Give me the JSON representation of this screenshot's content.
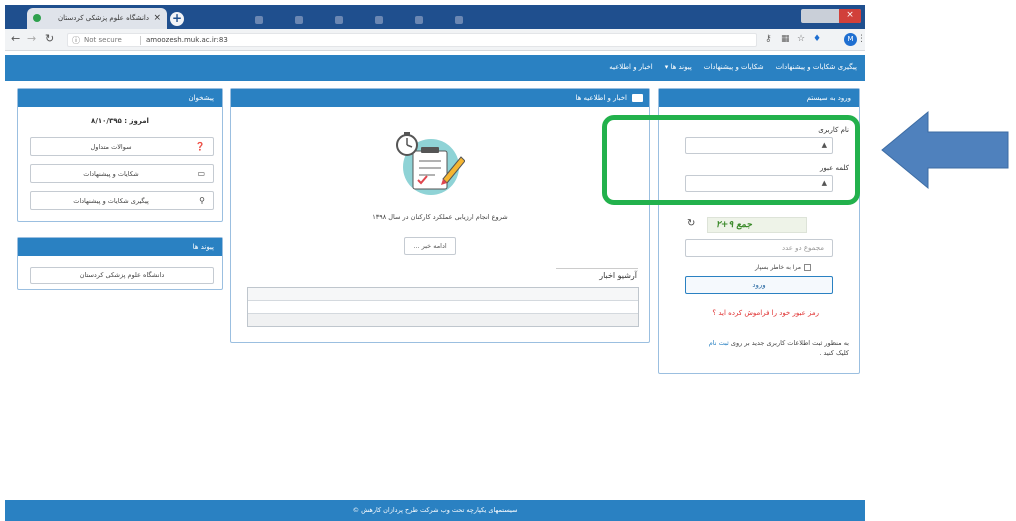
{
  "browser": {
    "tab_title": "دانشگاه علوم پزشکی کردستان",
    "tab_close": "×",
    "new_tab": "+",
    "security_icon": "info-circle-icon",
    "security_label": "Not secure",
    "url": "amoozesh.muk.ac.ir:83",
    "window_close": "×"
  },
  "nav": {
    "items": [
      "اخبار و اطلاعیه",
      "پیوند ها ▾",
      "شکایات و پیشنهادات",
      "پیگیری شکایات و پیشنهادات"
    ]
  },
  "login": {
    "header": "ورود به سیستم",
    "username_label": "نام کاربری",
    "password_label": "کلمه عبور",
    "captcha_text": "جمع ۹+۲",
    "sum_placeholder": "مجموع دو عدد",
    "remember_label": "مرا به خاطر بسپار",
    "submit_label": "ورود",
    "forgot_label": "رمز عبور خود را فراموش کرده اید ؟",
    "register_text_1": "به منظور ثبت اطلاعات کاربری جدید بر روی",
    "register_link": "ثبت نام",
    "register_text_2": "کلیک کنید ."
  },
  "news": {
    "header": "اخبار و اطلاعیه ها",
    "item_text": "شروع انجام ارزیابی عملکرد کارکنان در سال ۱۳۹۸",
    "more_label": "ادامه خبر ...",
    "archive_title": "آرشیو اخبار"
  },
  "side": {
    "header": "پیشخوان",
    "today": "امروز : ۸/۱۰/۳۹۵",
    "items": [
      {
        "label": "سوالات متداول",
        "icon": "question-icon"
      },
      {
        "label": "شکایات و پیشنهادات",
        "icon": "comments-icon"
      },
      {
        "label": "پیگیری شکایات و پیشنهادات",
        "icon": "search-icon"
      }
    ]
  },
  "links": {
    "header": "پیوند ها",
    "items": [
      "دانشگاه علوم پزشکی کردستان"
    ]
  },
  "footer": {
    "text": "سیستمهای یکپارچه تحت وب شرکت طرح پردازان کارهش ©"
  },
  "annotation": {
    "highlight_color": "#22b14c",
    "arrow_color": "#4f81bd"
  }
}
